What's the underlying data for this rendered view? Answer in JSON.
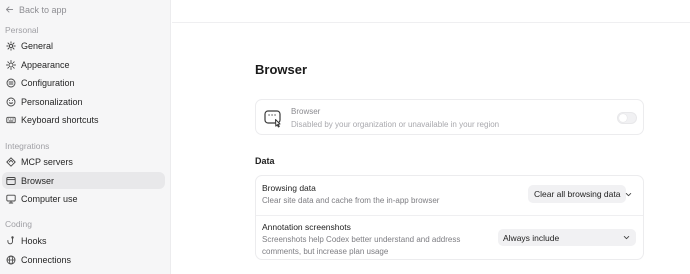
{
  "sidebar": {
    "back_label": "Back to app",
    "sections": [
      {
        "label": "Personal"
      },
      {
        "label": "Integrations"
      },
      {
        "label": "Coding"
      }
    ],
    "items": [
      {
        "label": "General",
        "icon": "gear-icon"
      },
      {
        "label": "Appearance",
        "icon": "sun-icon"
      },
      {
        "label": "Configuration",
        "icon": "sliders-icon"
      },
      {
        "label": "Personalization",
        "icon": "personalization-icon"
      },
      {
        "label": "Keyboard shortcuts",
        "icon": "keyboard-icon"
      },
      {
        "label": "MCP servers",
        "icon": "mcp-icon"
      },
      {
        "label": "Browser",
        "icon": "browser-icon"
      },
      {
        "label": "Computer use",
        "icon": "computer-icon"
      },
      {
        "label": "Hooks",
        "icon": "hook-icon"
      },
      {
        "label": "Connections",
        "icon": "globe-icon"
      }
    ],
    "active_item": "Browser"
  },
  "main": {
    "title": "Browser",
    "browser_card": {
      "title": "Browser",
      "subtitle": "Disabled by your organization or unavailable in your region",
      "toggle_on": false
    },
    "data_section": {
      "heading": "Data",
      "rows": [
        {
          "label": "Browsing data",
          "description": "Clear site data and cache from the in-app browser",
          "button_label": "Clear all browsing data"
        },
        {
          "label": "Annotation screenshots",
          "description": "Screenshots help Codex better understand and address comments, but increase plan usage",
          "select_value": "Always include"
        }
      ]
    }
  },
  "colors": {
    "sidebar_bg": "#f6f6f7",
    "active_item_bg": "#e8e8ea",
    "card_border": "#ececee"
  }
}
